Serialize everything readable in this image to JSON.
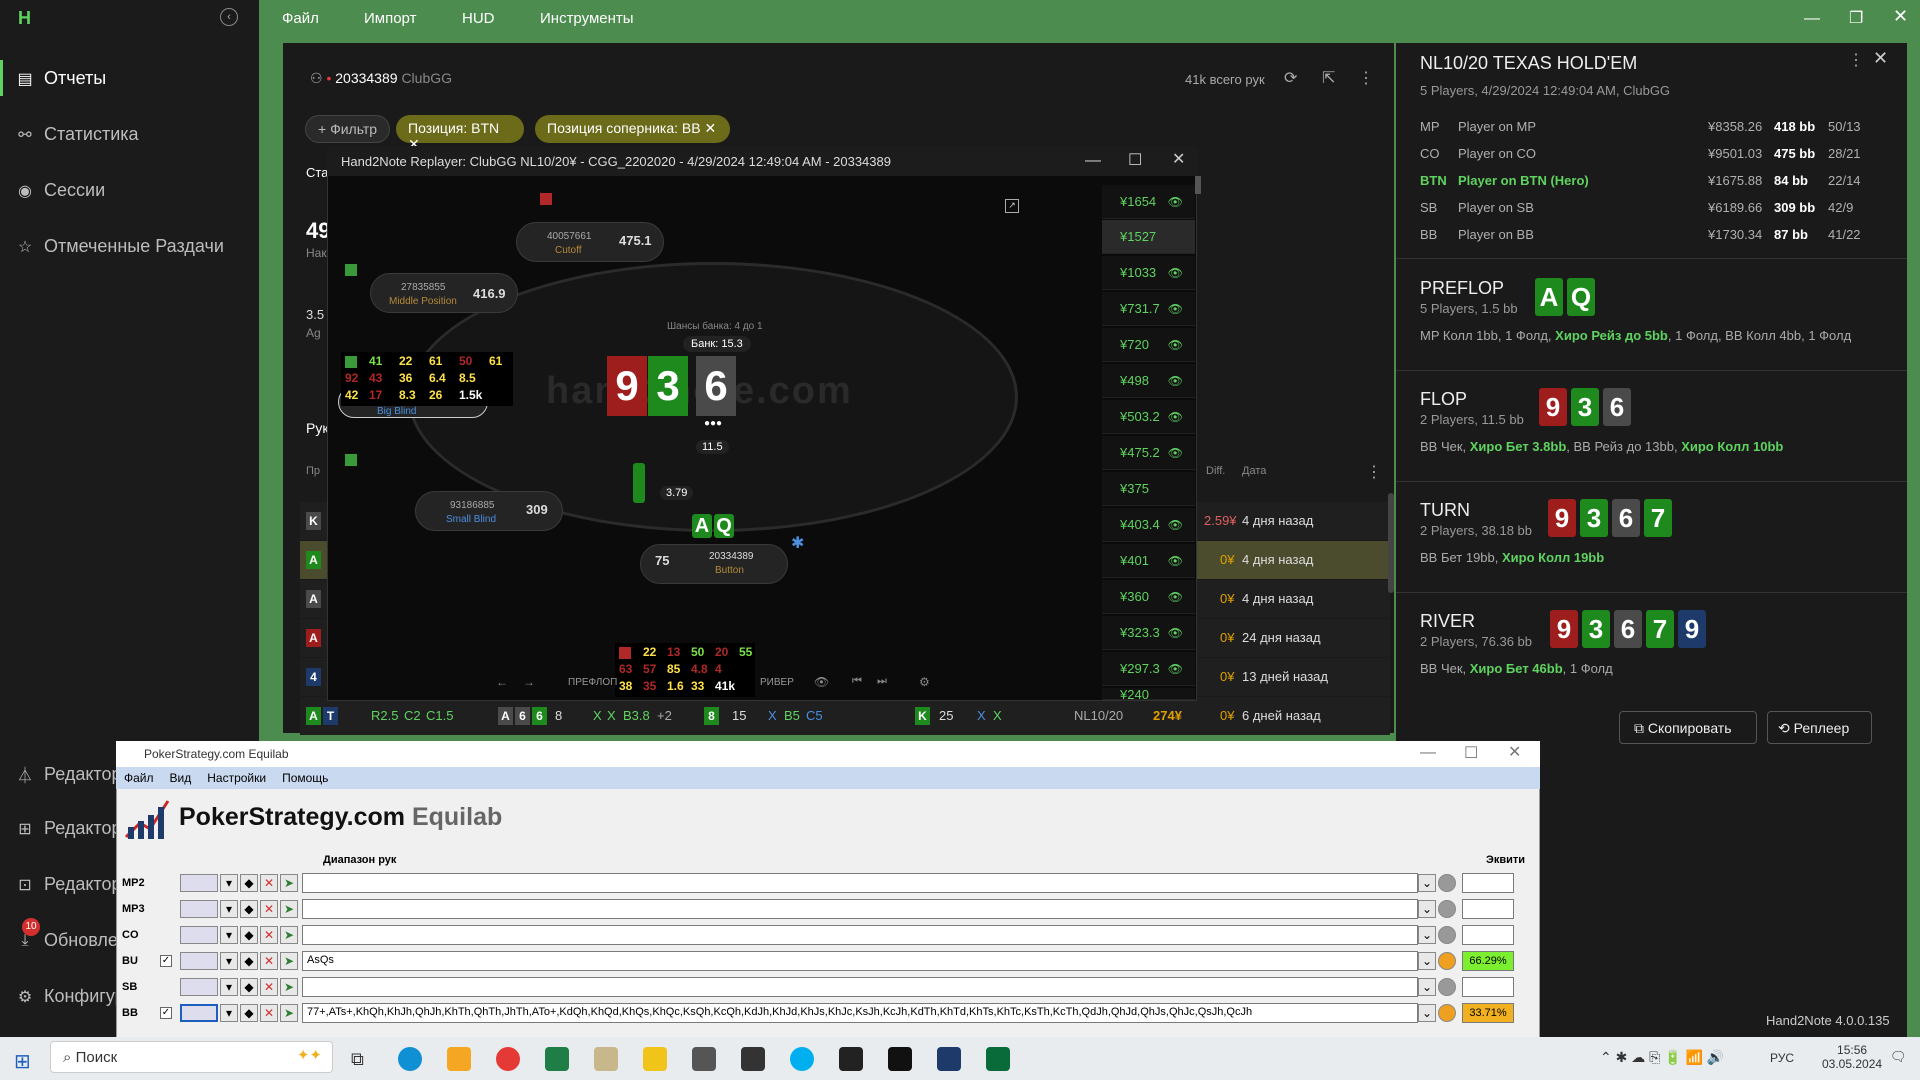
{
  "app": {
    "name": "Hand2Note",
    "version": "Hand2Note 4.0.0.135"
  },
  "menu": [
    "Файл",
    "Импорт",
    "HUD",
    "Инструменты"
  ],
  "sidebar": {
    "items": [
      {
        "label": "Отчеты",
        "icon": "report-icon"
      },
      {
        "label": "Статистика",
        "icon": "stats-icon"
      },
      {
        "label": "Сессии",
        "icon": "sessions-icon"
      },
      {
        "label": "Отмеченные Раздачи",
        "icon": "star-icon"
      }
    ],
    "bottom": [
      {
        "label": "Редактор",
        "icon": "filter-icon"
      },
      {
        "label": "Редактор",
        "icon": "layout-icon"
      },
      {
        "label": "Редактор",
        "icon": "editor-icon"
      },
      {
        "label": "Обновле",
        "icon": "download-icon",
        "badge": "10"
      },
      {
        "label": "Конфигур",
        "icon": "gear-icon"
      }
    ]
  },
  "report": {
    "player_id": "20334389",
    "site": "ClubGG",
    "total": "41k всего рук",
    "filter": "+ Фильтр",
    "chips": [
      "Позиция: BTN",
      "Позиция соперника: BB"
    ],
    "tab": "Ста",
    "big": "49",
    "sub": "Нак",
    "v2": "3.5",
    "v3": "Ag",
    "tab2": "Рук",
    "col1": "Пр",
    "col_diff": "Diff.",
    "col_date": "Дата"
  },
  "rows": [
    {
      "amt": "2.59¥",
      "date": "4 дня назад",
      "c": "K"
    },
    {
      "amt": "0¥",
      "date": "4 дня назад",
      "c": "A"
    },
    {
      "amt": "0¥",
      "date": "4 дня назад",
      "c": "A"
    },
    {
      "amt": "0¥",
      "date": "24 дня назад",
      "c": "A"
    },
    {
      "amt": "0¥",
      "date": "13 дней назад",
      "c": "4"
    }
  ],
  "lastrow": {
    "c1": "A",
    "c2": "T",
    "r1": "R2.5",
    "r2": "C2",
    "r3": "C1.5",
    "f1": "A",
    "f2": "6",
    "f3": "6",
    "f4": "8",
    "x1": "X",
    "x2": "X",
    "b1": "B3.8",
    "p2": "+2",
    "t1": "8",
    "t2": "15",
    "x3": "X",
    "b2": "B5",
    "c5": "C5",
    "r4": "K",
    "r5": "25",
    "x4": "X",
    "x5": "X",
    "limit": "NL10/20",
    "win": "274¥",
    "diff": "0¥",
    "date": "6 дней назад"
  },
  "replayer": {
    "title": "Hand2Note Replayer: ClubGG NL10/20¥ - CGG_2202020 - 4/29/2024 12:49:04 AM - 20334389",
    "watermark": "hand2note.com",
    "pot_odds": "Шансы банка: 4 до 1",
    "pot": "Банк: 15.3",
    "board": [
      "9",
      "3",
      "6"
    ],
    "chips_center": "11.5",
    "chips_btn": "3.79",
    "hero_cards": [
      "A",
      "Q"
    ],
    "seats": [
      {
        "id": "40057661",
        "pos": "Cutoff",
        "stack": "475.1"
      },
      {
        "id": "27835855",
        "pos": "Middle Position",
        "stack": "416.9"
      },
      {
        "id": "",
        "pos": "Big Blind",
        "stack": ""
      },
      {
        "id": "93186885",
        "pos": "Small Blind",
        "stack": "309"
      },
      {
        "id": "20334389",
        "pos": "Button",
        "stack": "75"
      }
    ],
    "hud1": [
      "41",
      "22",
      "61",
      "50",
      "61",
      "92",
      "43",
      "36",
      "6.4",
      "8.5",
      "42",
      "17",
      "8.3",
      "26",
      "1.5k"
    ],
    "hud2": [
      "22",
      "13",
      "50",
      "20",
      "55",
      "63",
      "57",
      "85",
      "4.8",
      "4",
      "38",
      "35",
      "1.6",
      "33",
      "41k"
    ],
    "controls": [
      "ПРЕФЛОП",
      "РИВЕР"
    ],
    "amounts": [
      "¥1654",
      "¥1527",
      "¥1033",
      "¥731.7",
      "¥720",
      "¥498",
      "¥503.2",
      "¥475.2",
      "¥375",
      "¥403.4",
      "¥401",
      "¥360",
      "¥323.3",
      "¥297.3",
      "¥240"
    ]
  },
  "hand": {
    "title": "NL10/20 TEXAS HOLD'EM",
    "sub": "5 Players, 4/29/2024 12:49:04 AM, ClubGG",
    "players": [
      {
        "pos": "MP",
        "name": "Player on MP",
        "money": "¥8358.26",
        "bb": "418 bb",
        "r": "50/13"
      },
      {
        "pos": "CO",
        "name": "Player on CO",
        "money": "¥9501.03",
        "bb": "475 bb",
        "r": "28/21"
      },
      {
        "pos": "BTN",
        "name": "Player on BTN (Hero)",
        "money": "¥1675.88",
        "bb": "84 bb",
        "r": "22/14"
      },
      {
        "pos": "SB",
        "name": "Player on SB",
        "money": "¥6189.66",
        "bb": "309 bb",
        "r": "42/9"
      },
      {
        "pos": "BB",
        "name": "Player on BB",
        "money": "¥1730.34",
        "bb": "87 bb",
        "r": "41/22"
      }
    ],
    "streets": [
      {
        "name": "PREFLOP",
        "sub": "5 Players, 1.5 bb",
        "a1": "MP Колл 1bb, 1 Фолд, ",
        "a2": "Хиро Рейз до 5bb",
        "a3": ", 1 Фолд, BB Колл 4bb, 1 Фолд",
        "cards": [
          "A",
          "Q"
        ]
      },
      {
        "name": "FLOP",
        "sub": "2 Players, 11.5 bb",
        "a1": "BB Чек, ",
        "a2": "Хиро Бет 3.8bb",
        "a3": ", BB Рейз до 13bb, ",
        "a4": "Хиро Колл 10bb",
        "cards": [
          "9",
          "3",
          "6"
        ]
      },
      {
        "name": "TURN",
        "sub": "2 Players, 38.18 bb",
        "a1": "BB Бет 19bb, ",
        "a2": "Хиро Колл 19bb",
        "cards": [
          "9",
          "3",
          "6",
          "7"
        ]
      },
      {
        "name": "RIVER",
        "sub": "2 Players, 76.36 bb",
        "a1": "BB Чек, ",
        "a2": "Хиро Бет 46bb",
        "a3": ", 1 Фолд",
        "cards": [
          "9",
          "3",
          "6",
          "7",
          "9"
        ]
      }
    ],
    "copy": "Скопировать",
    "replayer": "Реплеер"
  },
  "equilab": {
    "title": "PokerStrategy.com Equilab",
    "menu": [
      "Файл",
      "Вид",
      "Настройки",
      "Помощь"
    ],
    "logo1": "PokerStrategy.com",
    "logo2": "Equilab",
    "col_range": "Диапазон рук",
    "col_eq": "Эквити",
    "rows": [
      {
        "pos": "MP2",
        "range": "",
        "eq": ""
      },
      {
        "pos": "MP3",
        "range": "",
        "eq": ""
      },
      {
        "pos": "CO",
        "range": "",
        "eq": ""
      },
      {
        "pos": "BU",
        "range": "AsQs",
        "eq": "66.29%"
      },
      {
        "pos": "SB",
        "range": "",
        "eq": ""
      },
      {
        "pos": "BB",
        "range": "77+,ATs+,KhQh,KhJh,QhJh,KhTh,QhTh,JhTh,ATo+,KdQh,KhQd,KhQs,KhQc,KsQh,KcQh,KdJh,KhJd,KhJs,KhJc,KsJh,KcJh,KdTh,KhTd,KhTs,KhTc,KsTh,KcTh,QdJh,QhJd,QhJs,QhJc,QsJh,QcJh",
        "eq": "33.71%"
      }
    ]
  },
  "taskbar": {
    "search": "Поиск",
    "lang": "РУС",
    "time": "15:56",
    "date": "03.05.2024"
  }
}
